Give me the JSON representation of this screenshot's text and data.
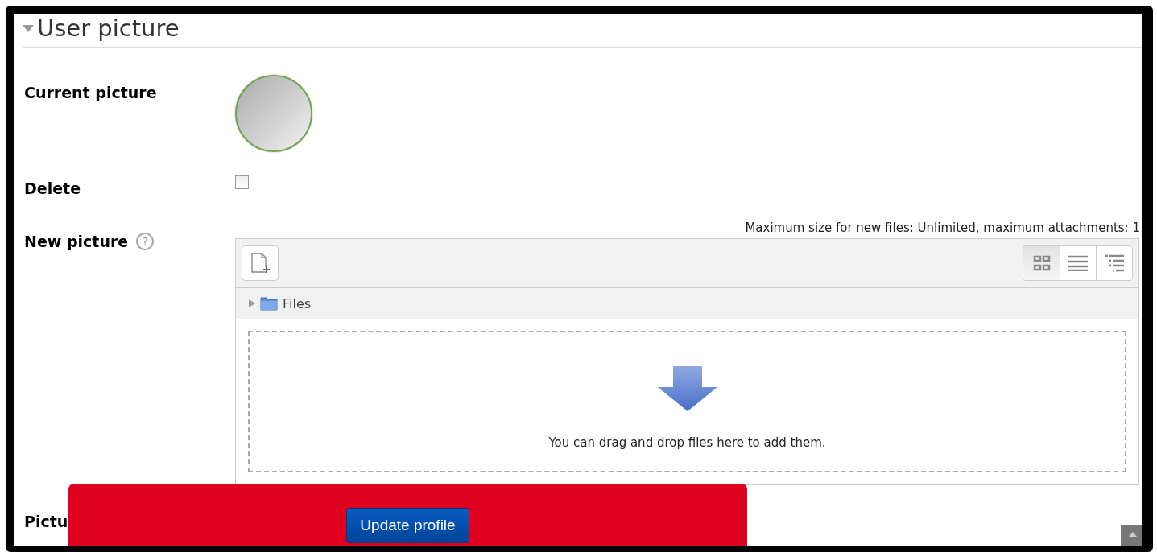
{
  "section": {
    "title": "User picture",
    "expanded": true
  },
  "fields": [
    {
      "kind": "picture",
      "label": "Current picture"
    },
    {
      "kind": "checkbox",
      "label": "Delete",
      "checked": false
    },
    {
      "kind": "filepicker",
      "label": "New picture",
      "help": "?"
    }
  ],
  "filepicker": {
    "limits": "Maximum size for new files: Unlimited, maximum attachments: 1",
    "views": [
      {
        "kind": "icons",
        "selected": true
      },
      {
        "kind": "list",
        "selected": false
      },
      {
        "kind": "tree",
        "selected": false
      }
    ],
    "path": "Files",
    "drop_hint": "You can drag and drop files here to add them."
  },
  "next_label": [
    "Pictu"
  ],
  "footer": {
    "button": "Update profile"
  }
}
